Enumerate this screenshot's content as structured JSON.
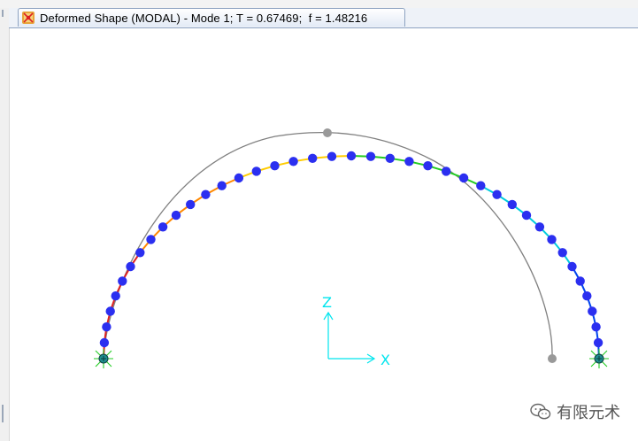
{
  "window": {
    "tab_title": "Deformed Shape (MODAL) - Mode 1; T = 0.67469;  f = 1.48216",
    "tab_icon": "structure-app-icon"
  },
  "axes_triad": {
    "vertical_label": "Z",
    "horizontal_label": "X",
    "color": "#00e5ee"
  },
  "model_view": {
    "undeformed_color": "#808080",
    "node_color": "#2b2ff0",
    "support_color": "#1f8f8f",
    "support_marker_color": "#22cc22",
    "segment_colors": [
      "#dd2222",
      "#ff8800",
      "#ffcc00",
      "#22cc22",
      "#00ccdd",
      "#0044ee"
    ],
    "node_count": 40
  },
  "watermark": {
    "text": "有限元术",
    "icon": "wechat-icon"
  }
}
